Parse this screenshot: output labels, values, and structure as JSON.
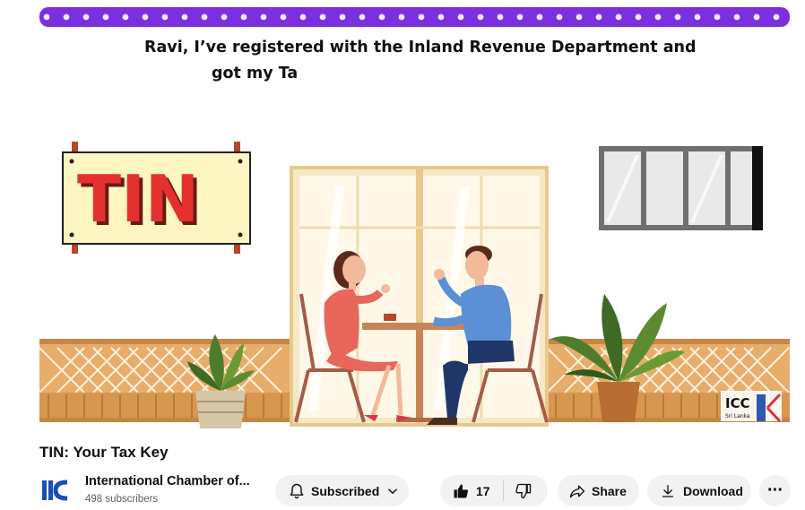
{
  "video": {
    "caption_line1": "Ravi, I’ve registered with the Inland Revenue Department and",
    "caption_line2": "got my Ta",
    "sign_text": "TIN",
    "watermark_text": "ICC",
    "watermark_sub": "Sri Lanka"
  },
  "title": "TIN: Your Tax Key",
  "channel": {
    "name": "International Chamber of...",
    "subscribers": "498 subscribers",
    "logo_text": "ICC"
  },
  "actions": {
    "subscribe_label": "Subscribed",
    "like_count": "17",
    "share_label": "Share",
    "download_label": "Download",
    "more_label": "···"
  },
  "colors": {
    "light_string": "#7b2fe0",
    "sign_text": "#e53030",
    "channel_blue": "#1a4fb3",
    "button_bg": "#f2f2f2"
  },
  "icons": [
    "bell-icon",
    "chevron-down-icon",
    "thumbs-up-icon",
    "thumbs-down-icon",
    "share-icon",
    "download-icon",
    "more-icon"
  ]
}
